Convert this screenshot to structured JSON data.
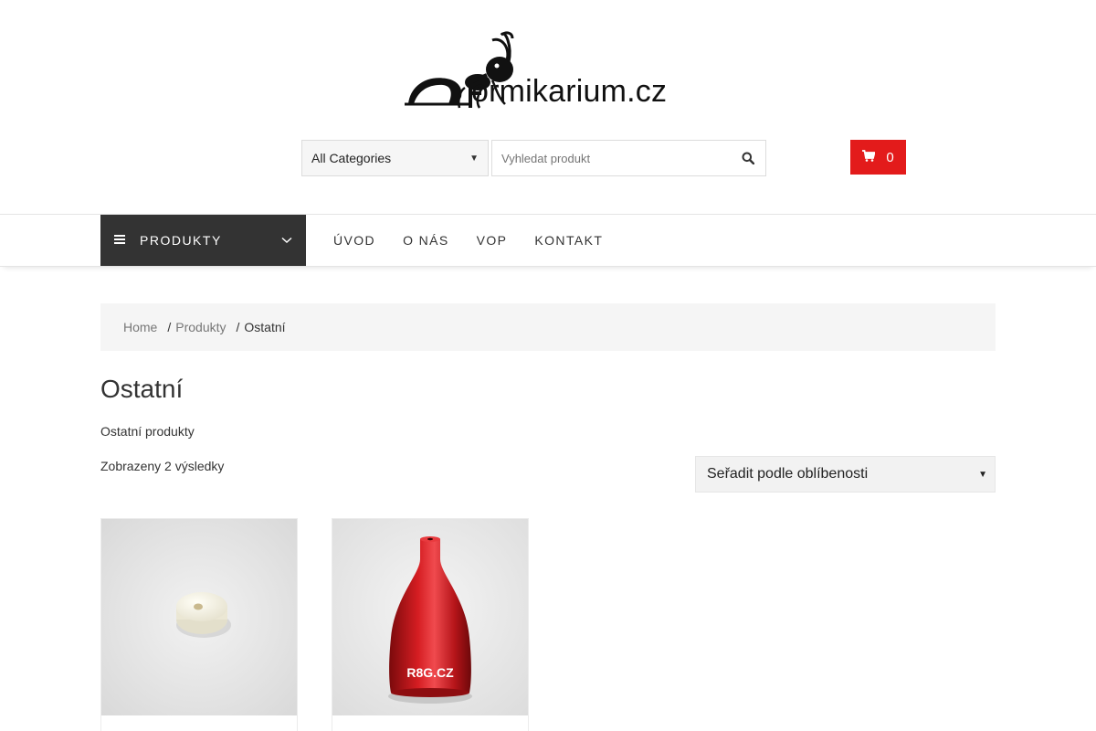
{
  "header": {
    "logo_text": "ormikarium.cz"
  },
  "search": {
    "category_selected": "All Categories",
    "placeholder": "Vyhledat produkt",
    "value": ""
  },
  "cart": {
    "count": "0"
  },
  "nav": {
    "categories_label": "PRODUKTY",
    "links": [
      "ÚVOD",
      "O NÁS",
      "VOP",
      "KONTAKT"
    ]
  },
  "breadcrumb": {
    "items": [
      "Home",
      "Produkty"
    ],
    "current": "Ostatní",
    "separator": "/"
  },
  "page": {
    "title": "Ostatní",
    "description": "Ostatní produkty",
    "result_count": "Zobrazeny 2 výsledky",
    "sort_selected": "Seřadit podle oblíbenosti"
  },
  "products": [
    {
      "image_alt": "white washer"
    },
    {
      "image_alt": "red bell",
      "image_text": "R8G.CZ"
    }
  ],
  "colors": {
    "accent": "#e31b1b",
    "menu_bg": "#333333"
  }
}
